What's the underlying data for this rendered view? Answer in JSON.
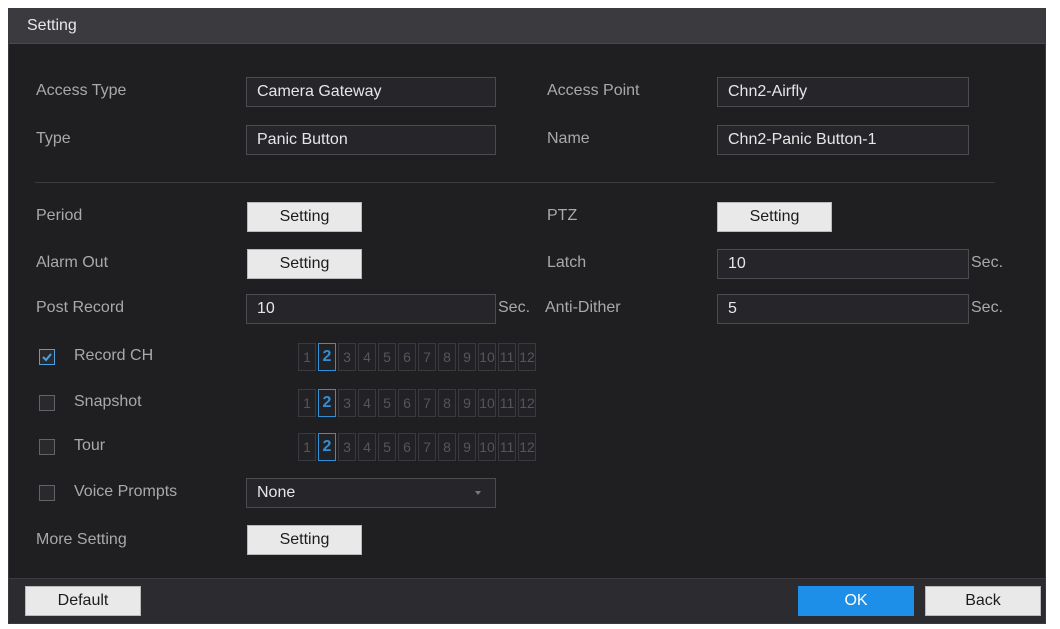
{
  "window": {
    "title": "Setting"
  },
  "info": {
    "access_type_label": "Access Type",
    "access_type_value": "Camera Gateway",
    "access_point_label": "Access Point",
    "access_point_value": "Chn2-Airfly",
    "type_label": "Type",
    "type_value": "Panic Button",
    "name_label": "Name",
    "name_value": "Chn2-Panic Button-1"
  },
  "settings": {
    "period_label": "Period",
    "period_button": "Setting",
    "ptz_label": "PTZ",
    "ptz_button": "Setting",
    "alarm_out_label": "Alarm Out",
    "alarm_out_button": "Setting",
    "latch_label": "Latch",
    "latch_value": "10",
    "latch_unit": "Sec.",
    "post_record_label": "Post Record",
    "post_record_value": "10",
    "post_record_unit": "Sec.",
    "anti_dither_label": "Anti-Dither",
    "anti_dither_value": "5",
    "anti_dither_unit": "Sec.",
    "record_ch_label": "Record CH",
    "record_ch_checked": true,
    "snapshot_label": "Snapshot",
    "snapshot_checked": false,
    "tour_label": "Tour",
    "tour_checked": false,
    "voice_prompts_label": "Voice Prompts",
    "voice_prompts_checked": false,
    "voice_prompts_value": "None",
    "more_setting_label": "More Setting",
    "more_setting_button": "Setting",
    "channels": [
      "1",
      "2",
      "3",
      "4",
      "5",
      "6",
      "7",
      "8",
      "9",
      "10",
      "11",
      "12"
    ],
    "selected_channel": "2"
  },
  "footer": {
    "default_button": "Default",
    "ok_button": "OK",
    "back_button": "Back"
  },
  "colors": {
    "accent": "#1e8fe8",
    "selected_channel": "#2f8fd8",
    "background": "#1f1f22"
  }
}
